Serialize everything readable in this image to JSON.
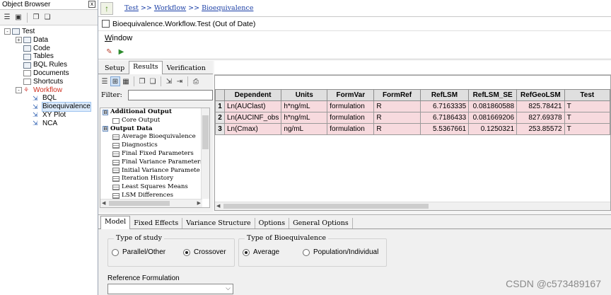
{
  "object_browser": {
    "title": "Object Browser",
    "pin": "x",
    "tree": [
      {
        "label": "Test",
        "level": 0,
        "expander": "-"
      },
      {
        "label": "Data",
        "level": 1,
        "expander": "+"
      },
      {
        "label": "Code",
        "level": 1
      },
      {
        "label": "Tables",
        "level": 1
      },
      {
        "label": "BQL Rules",
        "level": 1
      },
      {
        "label": "Documents",
        "level": 1
      },
      {
        "label": "Shortcuts",
        "level": 1
      },
      {
        "label": "Workflow",
        "level": 1,
        "expander": "-",
        "color": "#d03020"
      },
      {
        "label": "BQL",
        "level": 2
      },
      {
        "label": "Bioequivalence",
        "level": 2,
        "selected": true
      },
      {
        "label": "XY Plot",
        "level": 2
      },
      {
        "label": "NCA",
        "level": 2
      }
    ]
  },
  "breadcrumb": {
    "items": [
      "Test",
      "Workflow",
      "Bioequivalence"
    ],
    "separator": ">>"
  },
  "workflow": {
    "title": "Bioequivalence.Workflow.Test (Out of Date)",
    "menu_window_first": "W",
    "menu_window_rest": "indow"
  },
  "setup_tabs": [
    "Setup",
    "Results",
    "Verification"
  ],
  "filter_label": "Filter:",
  "output_tree": {
    "groups": [
      {
        "label": "Additional Output",
        "items": [
          "Core Output"
        ]
      },
      {
        "label": "Output Data",
        "items": [
          "Average Bioequivalence",
          "Diagnostics",
          "Final Fixed Parameters",
          "Final Variance Parameters",
          "Initial Variance Paramete",
          "Iteration History",
          "Least Squares Means",
          "LSM Differences"
        ]
      }
    ]
  },
  "results_table": {
    "columns": [
      "Dependent",
      "Units",
      "FormVar",
      "FormRef",
      "RefLSM",
      "RefLSM_SE",
      "RefGeoLSM",
      "Test"
    ],
    "rows": [
      [
        "1",
        "Ln(AUClast)",
        "h*ng/mL",
        "formulation",
        "R",
        "6.7163335",
        "0.081860588",
        "825.78421",
        "T"
      ],
      [
        "2",
        "Ln(AUCINF_obs",
        "h*ng/mL",
        "formulation",
        "R",
        "6.7186433",
        "0.081669206",
        "827.69378",
        "T"
      ],
      [
        "3",
        "Ln(Cmax)",
        "ng/mL",
        "formulation",
        "R",
        "5.5367661",
        "0.1250321",
        "253.85572",
        "T"
      ]
    ]
  },
  "option_tabs": [
    "Model",
    "Fixed Effects",
    "Variance Structure",
    "Options",
    "General Options"
  ],
  "study_type": {
    "legend": "Type of study",
    "options": [
      "Parallel/Other",
      "Crossover"
    ],
    "selected": "Crossover"
  },
  "be_type": {
    "legend": "Type of Bioequivalence",
    "options": [
      "Average",
      "Population/Individual"
    ],
    "selected": "Average"
  },
  "reference_formulation": {
    "label": "Reference Formulation",
    "value": ""
  },
  "watermark": "CSDN @c573489167"
}
